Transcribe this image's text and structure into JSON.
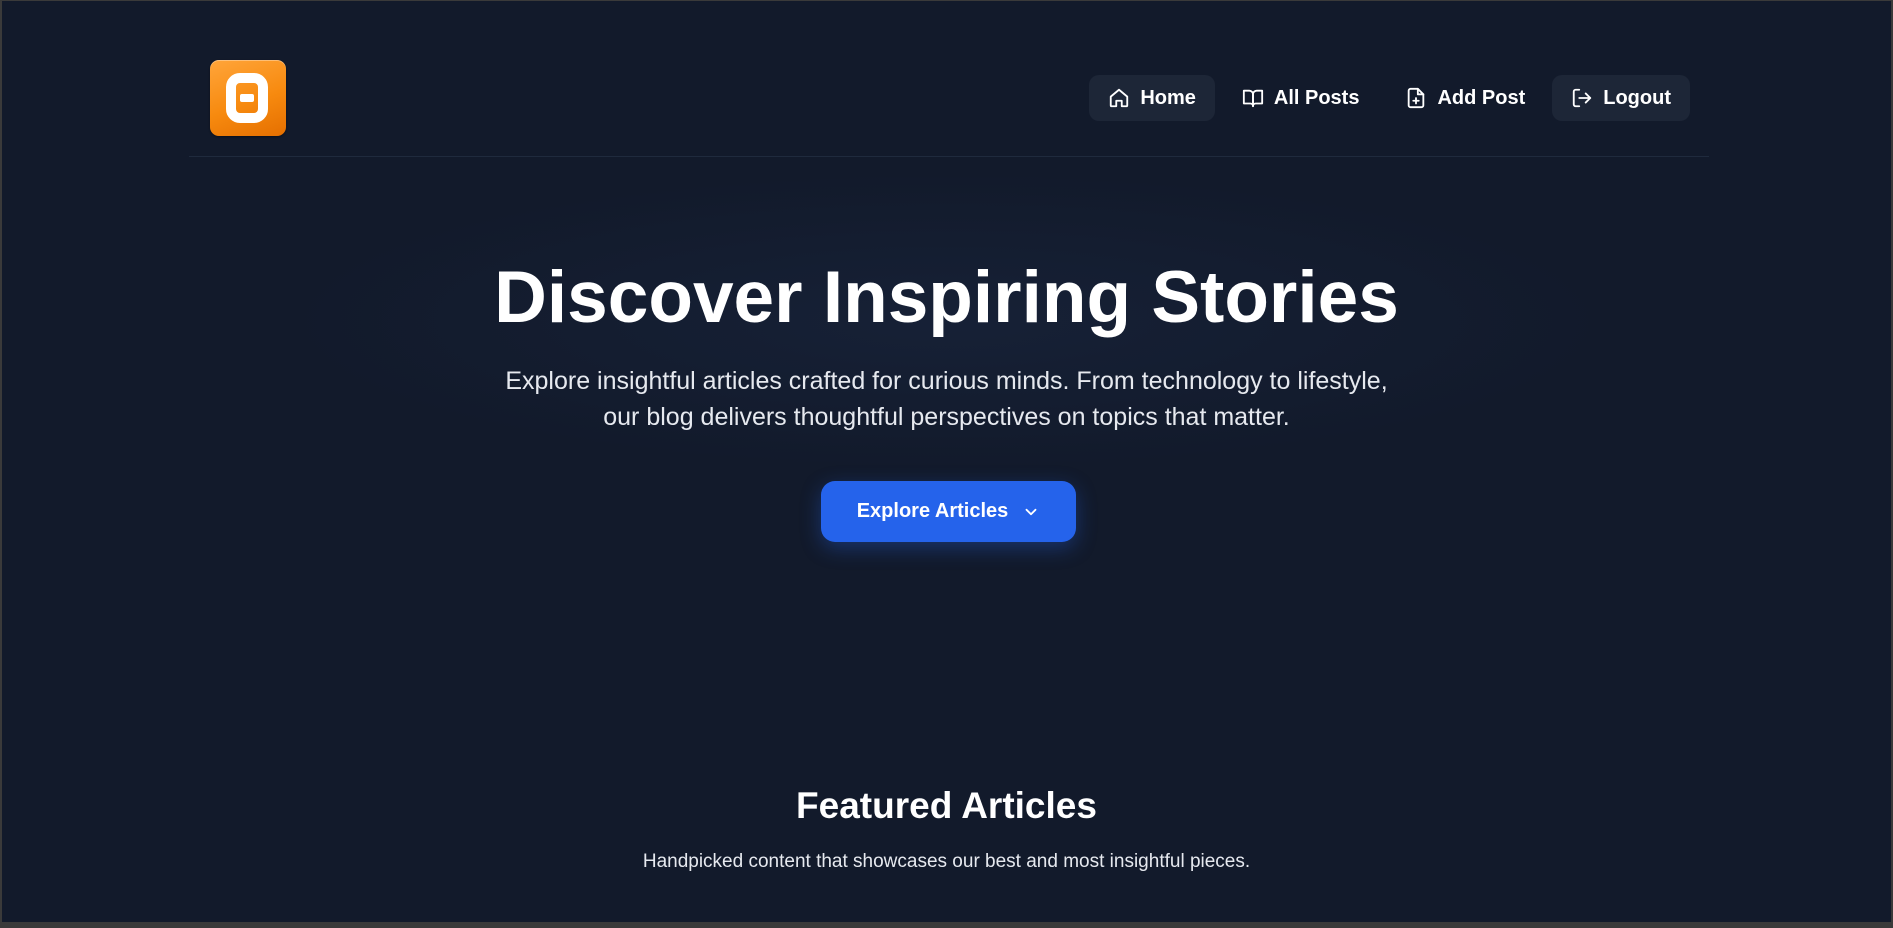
{
  "header": {
    "logo_icon": "blogger-logo-icon",
    "nav": [
      {
        "label": "Home",
        "icon": "home-icon"
      },
      {
        "label": "All Posts",
        "icon": "book-open-icon"
      },
      {
        "label": "Add Post",
        "icon": "file-plus-icon"
      },
      {
        "label": "Logout",
        "icon": "logout-icon"
      }
    ]
  },
  "hero": {
    "title": "Discover Inspiring Stories",
    "subtitle_line1": "Explore insightful articles crafted for curious minds. From technology to lifestyle,",
    "subtitle_line2": "our blog delivers thoughtful perspectives on topics that matter.",
    "cta_label": "Explore Articles",
    "cta_icon": "chevron-down-icon"
  },
  "featured": {
    "title": "Featured Articles",
    "subtitle": "Handpicked content that showcases our best and most insightful pieces."
  },
  "colors": {
    "background": "#121a2b",
    "accent": "#2563eb",
    "logo_orange": "#f78a0f",
    "nav_pill": "#1d2637"
  }
}
